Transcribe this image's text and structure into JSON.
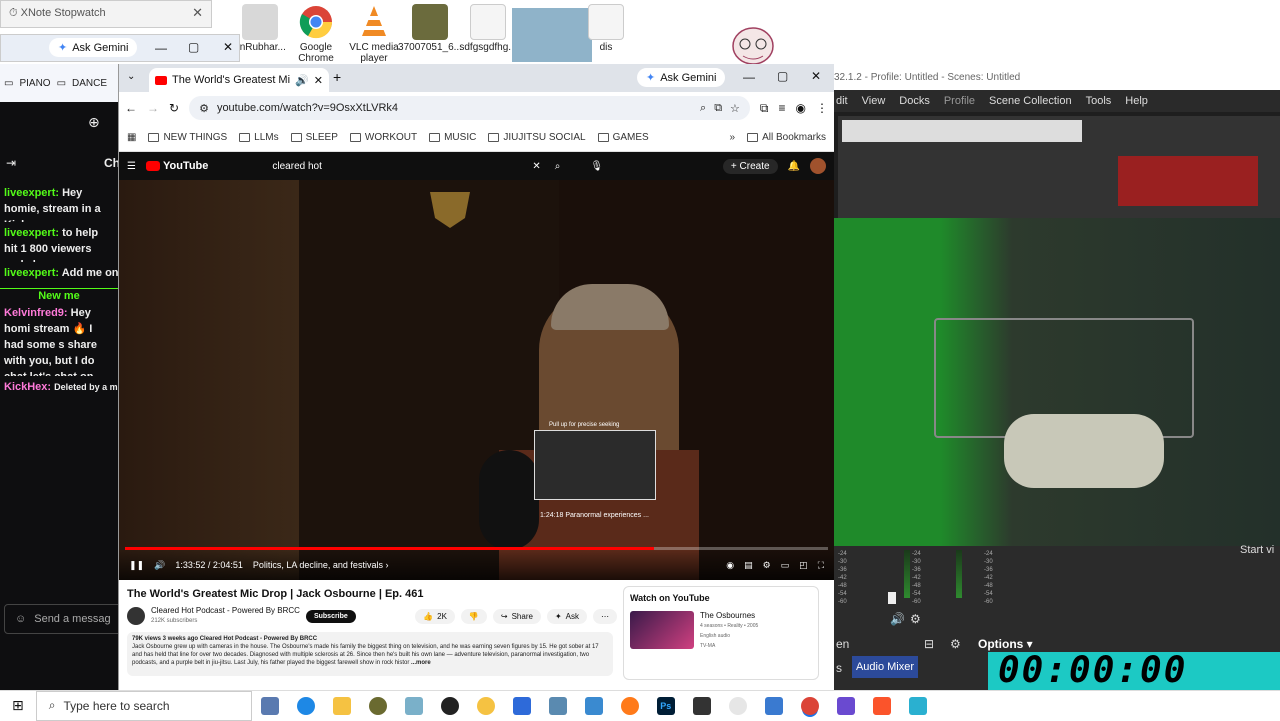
{
  "desktop": {
    "icons": [
      {
        "label": "anRubhar...",
        "color": "#bbbbbb"
      },
      {
        "label": "Google Chrome",
        "color": "#db4437"
      },
      {
        "label": "VLC media player",
        "color": "#f08a24"
      },
      {
        "label": "37007051_6...",
        "color": "#6b6b3d"
      },
      {
        "label": "sdfgsgdfhg...",
        "color": "#eeeeee"
      },
      {
        "label": "dis",
        "color": "#eeeeee"
      }
    ]
  },
  "xnote": {
    "title": "XNote Stopwatch"
  },
  "gemini_label": "Ask Gemini",
  "chat": {
    "bookmarks": [
      "PIANO",
      "DANCE"
    ],
    "header_label": "Ch",
    "messages": [
      {
        "user": "liveexpert:",
        "text": "Hey homie, stream in a Kick comm"
      },
      {
        "user": "liveexpert:",
        "text": "to help hit 1 800 viewers and also e"
      },
      {
        "user": "liveexpert:",
        "text": "Add me on"
      },
      {
        "user": "Kelvinfred9:",
        "text": "Hey homi stream 🔥 I had some s share with you, but I do chat let's chat on disco"
      },
      {
        "user": "KickHex:",
        "text": "Deleted by a m"
      }
    ],
    "new_messages": "New me",
    "send_placeholder": "Send a messag"
  },
  "chrome": {
    "tab_title": "The World's Greatest Mic D",
    "url": "youtube.com/watch?v=9OsxXtLVRk4",
    "bookmarks": [
      "NEW THINGS",
      "LLMs",
      "SLEEP",
      "WORKOUT",
      "MUSIC",
      "JIUJITSU SOCIAL",
      "GAMES"
    ],
    "all_bookmarks": "All Bookmarks"
  },
  "youtube": {
    "logo": "YouTube",
    "search_value": "cleared hot",
    "create_label": "Create",
    "seek_hint": "Pull up for precise seeking",
    "preview_time": "1:24:18",
    "preview_chapter": "Paranormal experiences ...",
    "time": "1:33:52 / 2:04:51",
    "chapter": "Politics, LA decline, and festivals",
    "progress": 0.752,
    "title": "The World's Greatest Mic Drop | Jack Osbourne | Ep. 461",
    "channel": "Cleared Hot Podcast - Powered By BRCC",
    "subscribers": "212K subscribers",
    "subscribe": "Subscribe",
    "likes": "2K",
    "share": "Share",
    "ask": "Ask",
    "meta": "79K views  3 weeks ago  Cleared Hot Podcast - Powered By BRCC",
    "description": "Jack Osbourne grew up with cameras in the house. The Osbourne's made his family the biggest thing on television, and he was earning seven figures by 15. He got sober at 17 and has held that line for over two decades. Diagnosed with multiple sclerosis at 26. Since then he's built his own lane — adventure television, paranormal investigation, two podcasts, and a purple belt in jiu-jitsu. Last July, his father played the biggest farewell show in rock histor",
    "more": "...more",
    "watch_on": "Watch on YouTube",
    "rec_title": "The Osbournes",
    "rec_sub1": "4 seasons • Reality • 2005",
    "rec_sub2": "English audio",
    "rec_rating": "TV-MA"
  },
  "obs": {
    "title": "32.1.2 - Profile: Untitled - Scenes: Untitled",
    "menu": [
      "dit",
      "View",
      "Docks",
      "Profile",
      "Scene Collection",
      "Tools",
      "Help"
    ],
    "meter_labels": [
      "-24",
      "-30",
      "-36",
      "-42",
      "-48",
      "-54",
      "-60"
    ],
    "options": "Options",
    "audio_mixer": "Audio Mixer",
    "start_label": "Start vi",
    "side_label": "s",
    "side_label2": "en",
    "stopwatch": "00:00:00"
  },
  "taskbar": {
    "search_placeholder": "Type here to search"
  }
}
